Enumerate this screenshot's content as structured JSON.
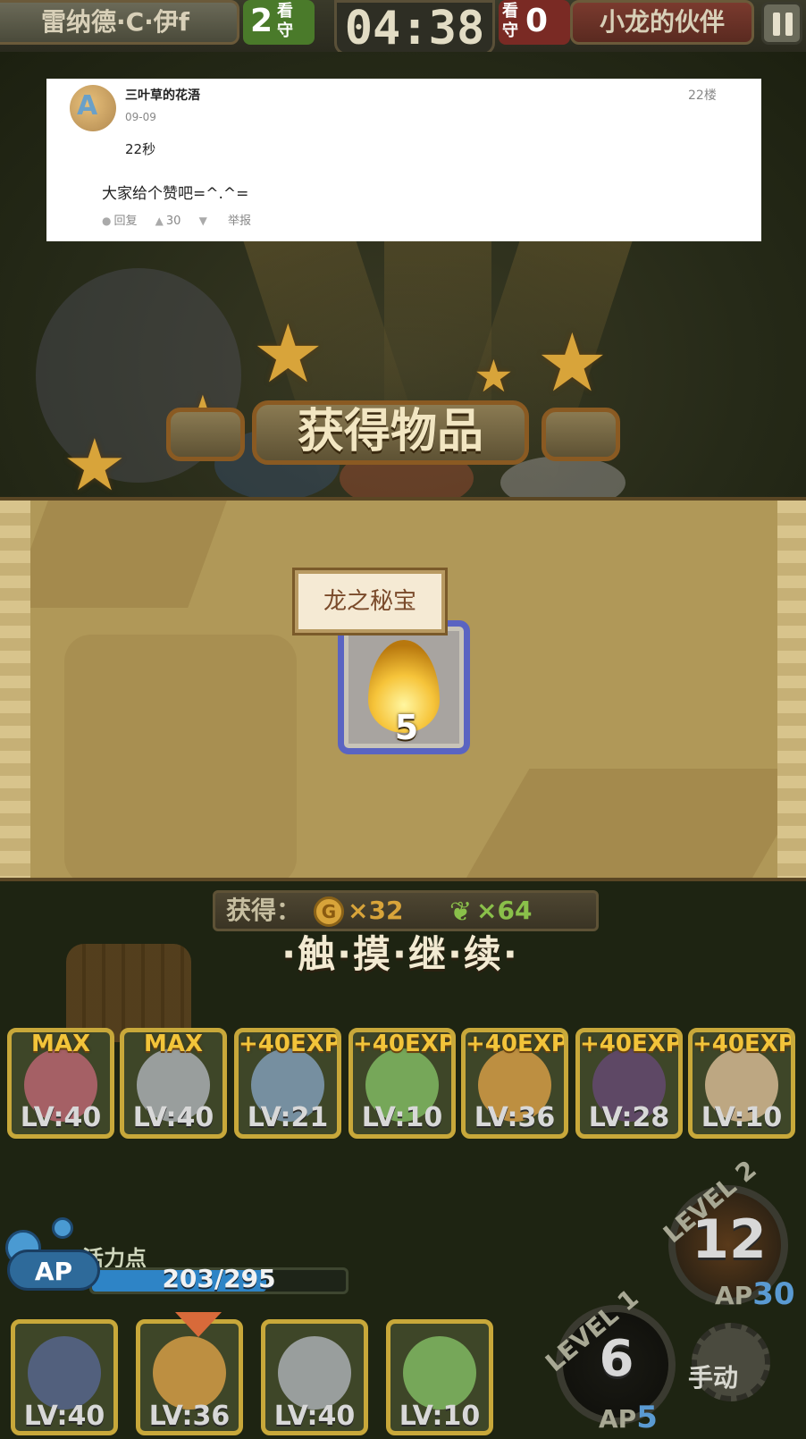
{
  "hud": {
    "left_team": "雷纳德·C·伊f",
    "left_guard_count": "2",
    "left_guard_label": "看守",
    "timer": "04:38",
    "right_guard_label": "看守",
    "right_guard_count": "0",
    "right_team": "小龙的伙伴"
  },
  "scene": {
    "banner_title": "获得物品"
  },
  "item": {
    "name": "龙之秘宝",
    "count": "5"
  },
  "rewards": {
    "label": "获得：",
    "coin_icon": "G",
    "gold": "×32",
    "feather_icon": "❦",
    "exp": "×64",
    "prompt": "·触·摸·继·续·"
  },
  "party": [
    {
      "tag": "MAX",
      "level": "LV:40",
      "color": "#c86a7a"
    },
    {
      "tag": "MAX",
      "level": "LV:40",
      "color": "#b8bcc4"
    },
    {
      "tag": "+40EXP",
      "level": "LV:21",
      "color": "#8aa8c8"
    },
    {
      "tag": "+40EXP",
      "level": "LV:10",
      "color": "#8ac86a"
    },
    {
      "tag": "+40EXP",
      "level": "LV:36",
      "color": "#e8a84a"
    },
    {
      "tag": "+40EXP",
      "level": "LV:28",
      "color": "#6a4a7a"
    },
    {
      "tag": "+40EXP",
      "level": "LV:10",
      "color": "#e8c8a0"
    }
  ],
  "ap": {
    "icon_text": "AP",
    "label": "活力点",
    "value": "203/295",
    "fraction": 0.688
  },
  "team": [
    {
      "level": "LV:40",
      "color": "#5a6a9a"
    },
    {
      "level": "LV:36",
      "color": "#e8a84a"
    },
    {
      "level": "LV:40",
      "color": "#b8bcc4"
    },
    {
      "level": "LV:10",
      "color": "#8ac86a"
    }
  ],
  "skills": {
    "big": {
      "level": "LEVEL 2",
      "number": "12",
      "ap_label": "AP",
      "ap_value": "30"
    },
    "small": {
      "level": "LEVEL 1",
      "number": "6",
      "ap_label": "AP",
      "ap_value": "5"
    },
    "manual": "手动"
  },
  "post": {
    "username": "三叶草的花浯",
    "date": "09-09",
    "floor": "22楼",
    "line1": "22秒",
    "line2": "大家给个赞吧=^.^=",
    "reply_label": "回复",
    "likes": "30",
    "report_label": "举报",
    "icons": {
      "reply": "comment-icon",
      "like": "thumbs-up-icon",
      "dislike": "thumbs-down-icon"
    }
  }
}
